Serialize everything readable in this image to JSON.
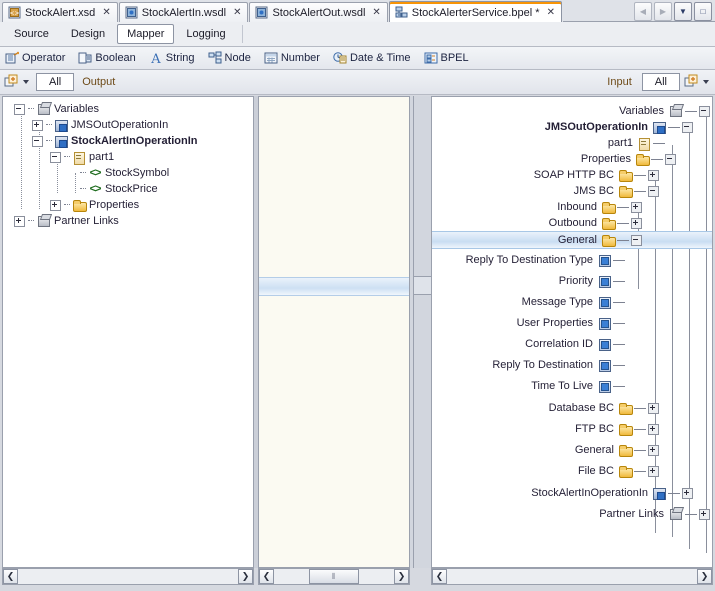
{
  "window": {
    "tabs": [
      {
        "label": "StockAlert.xsd",
        "icon": "xsd-file-icon",
        "close": "✕",
        "active": false,
        "modified": false
      },
      {
        "label": "StockAlertIn.wsdl",
        "icon": "wsdl-file-icon",
        "close": "✕",
        "active": false,
        "modified": false
      },
      {
        "label": "StockAlertOut.wsdl",
        "icon": "wsdl-file-icon",
        "close": "✕",
        "active": false,
        "modified": false
      },
      {
        "label": "StockAlerterService.bpel *",
        "icon": "bpel-file-icon",
        "close": "✕",
        "active": true,
        "modified": true
      }
    ],
    "tab_nav": [
      {
        "name": "scroll-tabs-left-button",
        "glyph": "◀",
        "enabled": false
      },
      {
        "name": "scroll-tabs-right-button",
        "glyph": "▶",
        "enabled": false
      },
      {
        "name": "tab-list-dropdown-button",
        "glyph": "▼",
        "enabled": true
      },
      {
        "name": "maximize-window-button",
        "glyph": "□",
        "enabled": true
      }
    ],
    "active_tab_accent": "#f79406"
  },
  "view_tabs": {
    "items": [
      "Source",
      "Design",
      "Mapper",
      "Logging"
    ],
    "selected": "Mapper"
  },
  "palette": {
    "items": [
      {
        "label": "Operator",
        "icon": "operator-icon"
      },
      {
        "label": "Boolean",
        "icon": "boolean-icon"
      },
      {
        "label": "String",
        "icon": "string-icon"
      },
      {
        "label": "Node",
        "icon": "node-icon"
      },
      {
        "label": "Number",
        "icon": "number-icon"
      },
      {
        "label": "Date & Time",
        "icon": "date-time-icon"
      },
      {
        "label": "BPEL",
        "icon": "bpel-icon"
      }
    ]
  },
  "filter_bar": {
    "left_dropdown_icon": "add-variable-icon",
    "left_all_label": "All",
    "output_label": "Output",
    "input_label": "Input",
    "right_all_label": "All",
    "right_dropdown_icon": "add-variable-icon"
  },
  "left_tree": {
    "nodes": [
      {
        "label": "Variables",
        "icon": "variables-icon",
        "indent": 0,
        "toggle": "minus",
        "bold": false
      },
      {
        "label": "JMSOutOperationIn",
        "icon": "message-icon",
        "indent": 1,
        "toggle": "plus",
        "bold": false
      },
      {
        "label": "StockAlertInOperationIn",
        "icon": "message-icon",
        "indent": 1,
        "toggle": "minus",
        "bold": true
      },
      {
        "label": "part1",
        "icon": "part-icon",
        "indent": 2,
        "toggle": "minus",
        "bold": false
      },
      {
        "label": "StockSymbol",
        "icon": "element-icon",
        "indent": 3,
        "toggle": "none",
        "bold": false
      },
      {
        "label": "StockPrice",
        "icon": "element-icon",
        "indent": 3,
        "toggle": "none",
        "bold": false
      },
      {
        "label": "Properties",
        "icon": "folder-icon",
        "indent": 2,
        "toggle": "plus",
        "bold": false
      },
      {
        "label": "Partner Links",
        "icon": "variables-icon",
        "indent": 0,
        "toggle": "plus",
        "bold": false
      }
    ]
  },
  "right_tree": {
    "nodes": [
      {
        "label": "Variables",
        "icon": "variables-icon",
        "toggle": "minus",
        "bold": false,
        "depth": 0,
        "highlighted": false
      },
      {
        "label": "JMSOutOperationIn",
        "icon": "message-icon",
        "toggle": "minus",
        "bold": true,
        "depth": 1,
        "highlighted": false
      },
      {
        "label": "part1",
        "icon": "part-icon",
        "toggle": "none",
        "bold": false,
        "depth": 2,
        "highlighted": false
      },
      {
        "label": "Properties",
        "icon": "folder-icon",
        "toggle": "minus",
        "bold": false,
        "depth": 2,
        "highlighted": false
      },
      {
        "label": "SOAP HTTP BC",
        "icon": "folder-icon",
        "toggle": "plus",
        "bold": false,
        "depth": 3,
        "highlighted": false
      },
      {
        "label": "JMS BC",
        "icon": "folder-icon",
        "toggle": "minus",
        "bold": false,
        "depth": 3,
        "highlighted": false
      },
      {
        "label": "Inbound",
        "icon": "folder-icon",
        "toggle": "plus",
        "bold": false,
        "depth": 4,
        "highlighted": false
      },
      {
        "label": "Outbound",
        "icon": "folder-icon",
        "toggle": "plus",
        "bold": false,
        "depth": 4,
        "highlighted": false
      },
      {
        "label": "General",
        "icon": "folder-icon",
        "toggle": "minus",
        "bold": false,
        "depth": 4,
        "highlighted": true
      },
      {
        "label": "Reply To Destination Type",
        "icon": "property-icon",
        "toggle": "none",
        "bold": false,
        "depth": 5,
        "highlighted": false
      },
      {
        "label": "Priority",
        "icon": "property-icon",
        "toggle": "none",
        "bold": false,
        "depth": 5,
        "highlighted": false
      },
      {
        "label": "Message Type",
        "icon": "property-icon",
        "toggle": "none",
        "bold": false,
        "depth": 5,
        "highlighted": false
      },
      {
        "label": "User Properties",
        "icon": "property-icon",
        "toggle": "none",
        "bold": false,
        "depth": 5,
        "highlighted": false
      },
      {
        "label": "Correlation ID",
        "icon": "property-icon",
        "toggle": "none",
        "bold": false,
        "depth": 5,
        "highlighted": false
      },
      {
        "label": "Reply To Destination",
        "icon": "property-icon",
        "toggle": "none",
        "bold": false,
        "depth": 5,
        "highlighted": false
      },
      {
        "label": "Time To Live",
        "icon": "property-icon",
        "toggle": "none",
        "bold": false,
        "depth": 5,
        "highlighted": false
      },
      {
        "label": "Database BC",
        "icon": "folder-icon",
        "toggle": "plus",
        "bold": false,
        "depth": 3,
        "highlighted": false
      },
      {
        "label": "FTP BC",
        "icon": "folder-icon",
        "toggle": "plus",
        "bold": false,
        "depth": 3,
        "highlighted": false
      },
      {
        "label": "General",
        "icon": "folder-icon",
        "toggle": "plus",
        "bold": false,
        "depth": 3,
        "highlighted": false
      },
      {
        "label": "File BC",
        "icon": "folder-icon",
        "toggle": "plus",
        "bold": false,
        "depth": 3,
        "highlighted": false
      },
      {
        "label": "StockAlertInOperationIn",
        "icon": "message-icon",
        "toggle": "plus",
        "bold": false,
        "depth": 1,
        "highlighted": false
      },
      {
        "label": "Partner Links",
        "icon": "variables-icon",
        "toggle": "plus",
        "bold": false,
        "depth": 0,
        "highlighted": false
      }
    ]
  },
  "scrollbars": {
    "left_arrow_glyph": "❮",
    "right_arrow_glyph": "❯",
    "thumb_grip": "⦀"
  }
}
